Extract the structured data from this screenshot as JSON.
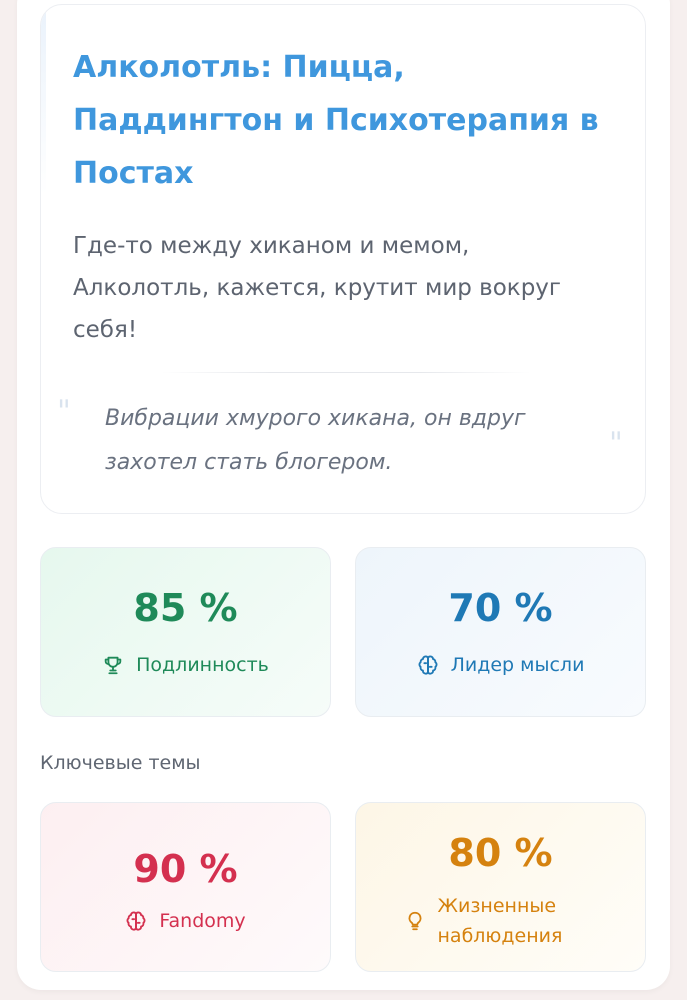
{
  "post": {
    "title": "Алколотль: Пицца, Паддингтон и Психотерапия в Постах",
    "description": "Где-то между хиканом и мемом, Алколотль, кажется, крутит мир вокруг себя!",
    "quote_open": "\"",
    "quote": "Вибрации хмурого хикана, он вдруг захотел стать блогером.",
    "quote_close": "\""
  },
  "metrics": [
    {
      "value": "85 %",
      "label": "Подлинность",
      "icon": "trophy-icon",
      "color": "#1f8a59"
    },
    {
      "value": "70 %",
      "label": "Лидер мысли",
      "icon": "brain-icon",
      "color": "#1f79b5"
    }
  ],
  "topics_heading": "Ключевые темы",
  "topics": [
    {
      "value": "90 %",
      "label": "Fandomy",
      "icon": "brain-icon",
      "color": "#d4304f"
    },
    {
      "value": "80 %",
      "label": "Жизненные наблюдения",
      "icon": "lightbulb-icon",
      "color": "#d5820f"
    }
  ]
}
